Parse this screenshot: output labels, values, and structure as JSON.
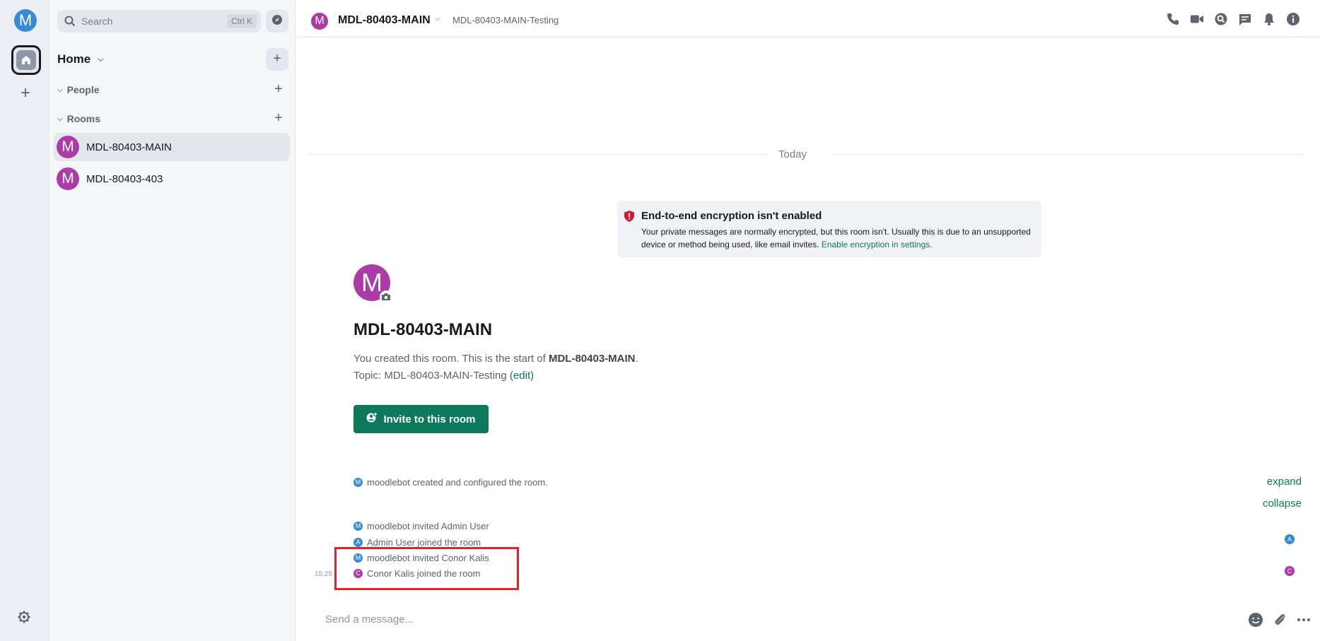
{
  "user": {
    "avatar_letter": "M"
  },
  "spacebar": {
    "add_label": "+"
  },
  "search": {
    "placeholder": "Search",
    "shortcut": "Ctrl K"
  },
  "roomlist": {
    "home_label": "Home",
    "add_label": "+",
    "sections": [
      {
        "label": "People"
      },
      {
        "label": "Rooms"
      }
    ],
    "rooms": [
      {
        "avatar_letter": "M",
        "name": "MDL-80403-MAIN",
        "active": true
      },
      {
        "avatar_letter": "M",
        "name": "MDL-80403-403",
        "active": false
      }
    ]
  },
  "header": {
    "avatar_letter": "M",
    "title": "MDL-80403-MAIN",
    "topic": "MDL-80403-MAIN-Testing",
    "icons": [
      "phone-icon",
      "video-icon",
      "threads-icon",
      "chat-icon",
      "bell-icon",
      "info-icon"
    ]
  },
  "timeline": {
    "date_separator": "Today",
    "encryption_notice": {
      "title": "End-to-end encryption isn't enabled",
      "body": "Your private messages are normally encrypted, but this room isn't. Usually this is due to an unsupported device or method being used, like email invites.",
      "link": "Enable encryption in settings."
    },
    "room_intro": {
      "avatar_letter": "M",
      "title": "MDL-80403-MAIN",
      "created_prefix": "You created this room. This is the start of ",
      "created_room": "MDL-80403-MAIN",
      "created_suffix": ".",
      "topic_prefix": "Topic: MDL-80403-MAIN-Testing ",
      "topic_edit_open": "(",
      "topic_edit": "edit",
      "topic_edit_close": ")",
      "invite_button": "Invite to this room"
    },
    "events": [
      {
        "avatar": "M",
        "text": "moodlebot created and configured the room."
      },
      {
        "avatar": "M",
        "text": "moodlebot invited Admin User"
      },
      {
        "avatar": "A",
        "text": "Admin User joined the room"
      },
      {
        "avatar": "M",
        "text": "moodlebot invited Conor Kalis"
      },
      {
        "avatar": "C",
        "text": "Conor Kalis joined the room"
      }
    ],
    "expand_label": "expand",
    "collapse_label": "collapse",
    "timestamp": "15:25",
    "receipts": [
      "A",
      "C"
    ]
  },
  "composer": {
    "placeholder": "Send a message..."
  },
  "colors": {
    "accent": "#0c7a5a",
    "room_avatar": "#ac3ba8",
    "user_avatar": "#368bd6",
    "highlight": "#e8202b"
  }
}
